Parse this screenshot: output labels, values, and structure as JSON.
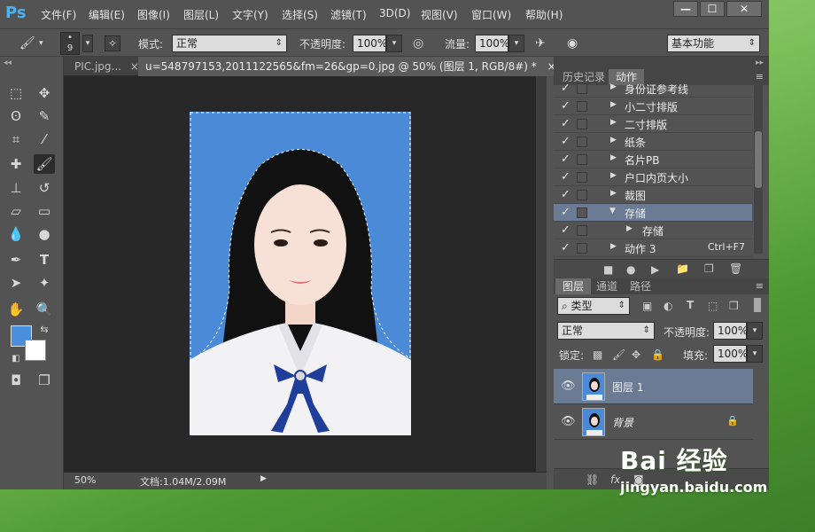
{
  "app": {
    "logo": "Ps",
    "menu": [
      "文件(F)",
      "编辑(E)",
      "图像(I)",
      "图层(L)",
      "文字(Y)",
      "选择(S)",
      "滤镜(T)",
      "3D(D)",
      "视图(V)",
      "窗口(W)",
      "帮助(H)"
    ],
    "window_buttons": [
      "—",
      "☐",
      "✕"
    ]
  },
  "options": {
    "brush_size": "9",
    "mode_label": "模式:",
    "mode_value": "正常",
    "opacity_label": "不透明度:",
    "opacity_value": "100%",
    "flow_label": "流量:",
    "flow_value": "100%",
    "workspace": "基本功能"
  },
  "tabs": [
    {
      "label": "PIC.jpg...",
      "close": "×"
    },
    {
      "label": "u=548797153,2011122565&fm=26&gp=0.jpg @ 50% (图层 1, RGB/8#) *",
      "close": "×"
    }
  ],
  "status": {
    "zoom": "50%",
    "doc": "文档:1.04M/2.09M"
  },
  "actions_panel": {
    "tabs": [
      "历史记录",
      "动作"
    ],
    "items": [
      {
        "name": "身份证参考线",
        "expanded": false,
        "indent": 0,
        "shortcut": ""
      },
      {
        "name": "小二寸排版",
        "expanded": false,
        "indent": 0,
        "shortcut": ""
      },
      {
        "name": "二寸排版",
        "expanded": false,
        "indent": 0,
        "shortcut": ""
      },
      {
        "name": "纸条",
        "expanded": false,
        "indent": 0,
        "shortcut": ""
      },
      {
        "name": "名片PB",
        "expanded": false,
        "indent": 0,
        "shortcut": ""
      },
      {
        "name": "户口内页大小",
        "expanded": false,
        "indent": 0,
        "shortcut": ""
      },
      {
        "name": "裁图",
        "expanded": false,
        "indent": 0,
        "shortcut": ""
      },
      {
        "name": "存储",
        "expanded": true,
        "indent": 0,
        "shortcut": "",
        "selected": true
      },
      {
        "name": "存储",
        "expanded": false,
        "indent": 1,
        "shortcut": ""
      },
      {
        "name": "动作 3",
        "expanded": false,
        "indent": 0,
        "shortcut": "Ctrl+F7"
      }
    ]
  },
  "layers_panel": {
    "tabs": [
      "图层",
      "通道",
      "路径"
    ],
    "filter": "类型",
    "blend_mode": "正常",
    "opacity_label": "不透明度:",
    "opacity_value": "100%",
    "lock_label": "锁定:",
    "fill_label": "填充:",
    "fill_value": "100%",
    "layers": [
      {
        "name": "图层 1",
        "selected": true,
        "locked": false
      },
      {
        "name": "背景",
        "selected": false,
        "locked": true
      }
    ]
  },
  "watermark": {
    "brand": "Bai 经验",
    "url": "jingyan.baidu.com"
  },
  "colors": {
    "foreground": "#4a8fde",
    "background": "#ffffff",
    "photo_bg": "#4a8ad6",
    "selected_row": "#6b7b94"
  }
}
